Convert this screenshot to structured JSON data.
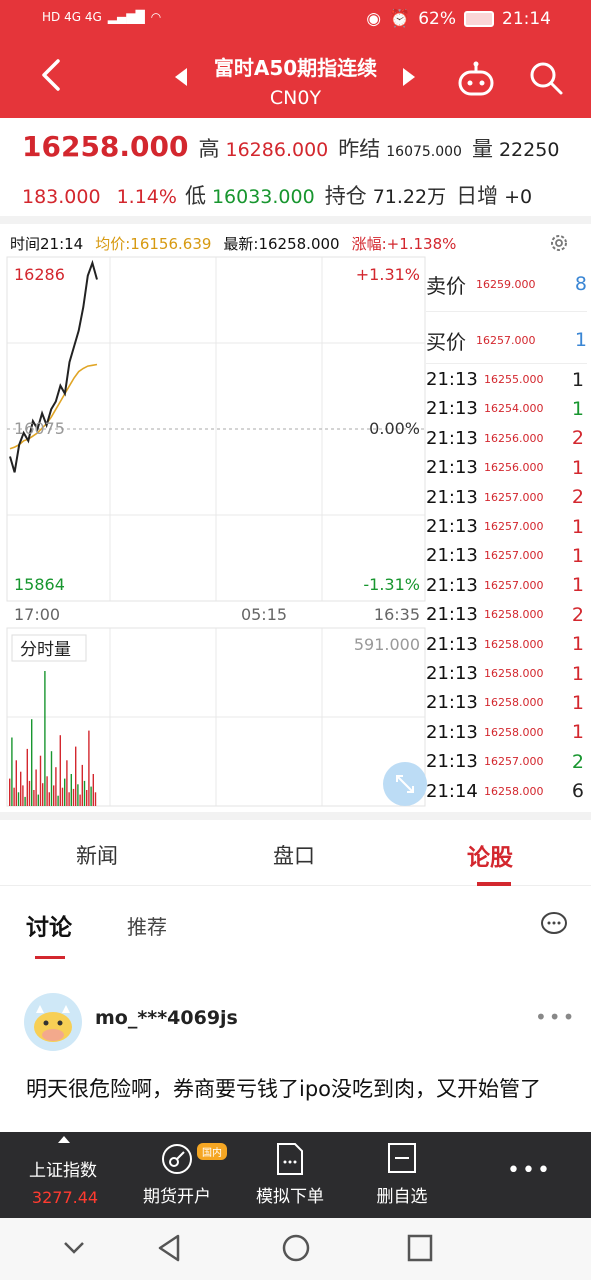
{
  "status_bar": {
    "left_text": "HD 4G 4G",
    "battery": "62%",
    "time": "21:14"
  },
  "header": {
    "title": "富时A50期指连续",
    "code": "CN0Y"
  },
  "quote": {
    "price": "16258.000",
    "high_label": "高",
    "high": "16286.000",
    "prev_close_label": "昨结",
    "prev_close": "16075.000",
    "volume_label": "量",
    "volume": "22250",
    "change": "183.000",
    "change_pct": "1.14%",
    "low_label": "低",
    "low": "16033.000",
    "open_interest_label": "持仓",
    "open_interest": "71.22万",
    "daily_inc_label": "日增",
    "daily_inc": "+0"
  },
  "chart_info": {
    "time": "时间21:14",
    "avg": "均价:16156.639",
    "latest": "最新:16258.000",
    "change": "涨幅:+1.138%"
  },
  "chart_labels": {
    "upper_price": "16286",
    "lower_price": "15864",
    "mid_price": "16075",
    "upper_pct": "+1.31%",
    "mid_pct": "0.00%",
    "lower_pct": "-1.31%",
    "time_start": "17:00",
    "time_mid": "05:15",
    "time_end": "16:35",
    "volume_title": "分时量",
    "volume_max": "591.000"
  },
  "chart_data": {
    "type": "line",
    "series": [
      {
        "name": "最新",
        "values": [
          16040,
          16020,
          16055,
          16070,
          16060,
          16085,
          16075,
          16095,
          16080,
          16100,
          16110,
          16130,
          16120,
          16160,
          16180,
          16200,
          16230,
          16270,
          16286,
          16265
        ]
      },
      {
        "name": "均价",
        "values": [
          16050,
          16052,
          16055,
          16060,
          16062,
          16066,
          16070,
          16076,
          16082,
          16090,
          16100,
          16110,
          16120,
          16130,
          16140,
          16148,
          16152,
          16155,
          16156,
          16157
        ]
      }
    ],
    "ylim": [
      15864,
      16286
    ],
    "volume": [
      120,
      300,
      80,
      200,
      60,
      150,
      90,
      40,
      250,
      110,
      380,
      70,
      160,
      50,
      220,
      100,
      591,
      130,
      60,
      240,
      90,
      170,
      45,
      310,
      80,
      120,
      200,
      60,
      140,
      75,
      260,
      95,
      50,
      180,
      110,
      70,
      330,
      85,
      140,
      60
    ]
  },
  "order_book": {
    "ask_label": "卖价",
    "ask_price": "16259.000",
    "ask_vol": "8",
    "bid_label": "买价",
    "bid_price": "16257.000",
    "bid_vol": "1",
    "trades": [
      {
        "time": "21:13",
        "price": "16255.000",
        "vol": "1",
        "color": "#222222"
      },
      {
        "time": "21:13",
        "price": "16254.000",
        "vol": "1",
        "color": "#18962f"
      },
      {
        "time": "21:13",
        "price": "16256.000",
        "vol": "2",
        "color": "#d3272e"
      },
      {
        "time": "21:13",
        "price": "16256.000",
        "vol": "1",
        "color": "#d3272e"
      },
      {
        "time": "21:13",
        "price": "16257.000",
        "vol": "2",
        "color": "#d3272e"
      },
      {
        "time": "21:13",
        "price": "16257.000",
        "vol": "1",
        "color": "#d3272e"
      },
      {
        "time": "21:13",
        "price": "16257.000",
        "vol": "1",
        "color": "#d3272e"
      },
      {
        "time": "21:13",
        "price": "16257.000",
        "vol": "1",
        "color": "#d3272e"
      },
      {
        "time": "21:13",
        "price": "16258.000",
        "vol": "2",
        "color": "#d3272e"
      },
      {
        "time": "21:13",
        "price": "16258.000",
        "vol": "1",
        "color": "#d3272e"
      },
      {
        "time": "21:13",
        "price": "16258.000",
        "vol": "1",
        "color": "#d3272e"
      },
      {
        "time": "21:13",
        "price": "16258.000",
        "vol": "1",
        "color": "#d3272e"
      },
      {
        "time": "21:13",
        "price": "16258.000",
        "vol": "1",
        "color": "#d3272e"
      },
      {
        "time": "21:13",
        "price": "16257.000",
        "vol": "2",
        "color": "#18962f"
      },
      {
        "time": "21:14",
        "price": "16258.000",
        "vol": "6",
        "color": "#222222"
      }
    ]
  },
  "tabs": {
    "news": "新闻",
    "pankou": "盘口",
    "stocks": "论股"
  },
  "subtabs": {
    "discuss": "讨论",
    "recommend": "推荐"
  },
  "post": {
    "username": "mo_***4069js",
    "text": "明天很危险啊，券商要亏钱了ipo没吃到肉，又开始管了"
  },
  "toolbar": {
    "index_name": "上证指数",
    "index_value": "3277.44",
    "futures_account": "期货开户",
    "badge": "国内",
    "sim_order": "模拟下单",
    "remove_watch": "删自选"
  },
  "colors": {
    "brand_red": "#e5353a",
    "up_red": "#d3272e",
    "down_green": "#18962f",
    "avg_line": "#e0a526"
  }
}
